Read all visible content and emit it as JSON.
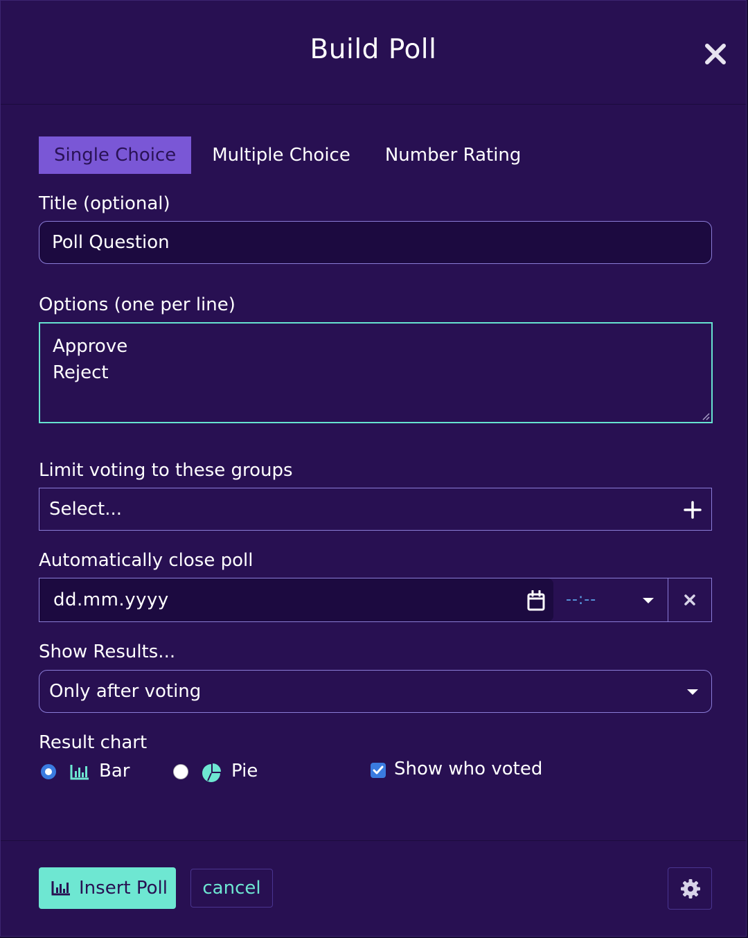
{
  "dialog": {
    "title": "Build Poll",
    "close_icon": "close-icon"
  },
  "tabs": [
    {
      "label": "Single Choice",
      "active": true
    },
    {
      "label": "Multiple Choice",
      "active": false
    },
    {
      "label": "Number Rating",
      "active": false
    }
  ],
  "form": {
    "title_label": "Title (optional)",
    "title_value": "Poll Question",
    "options_label": "Options (one per line)",
    "options": [
      "Approve",
      "Reject"
    ],
    "groups_label": "Limit voting to these groups",
    "groups_placeholder": "Select...",
    "close_label": "Automatically close poll",
    "date_placeholder": "dd.mm.yyyy",
    "time_placeholder": "--:--",
    "results_label": "Show Results...",
    "results_value": "Only after voting",
    "chart_label": "Result chart",
    "chart_options": [
      {
        "label": "Bar",
        "icon": "bar-chart-icon",
        "selected": true
      },
      {
        "label": "Pie",
        "icon": "pie-chart-icon",
        "selected": false
      }
    ],
    "show_voters_label": "Show who voted",
    "show_voters_checked": true
  },
  "footer": {
    "insert_label": "Insert Poll",
    "cancel_label": "cancel",
    "settings_icon": "gear-icon"
  },
  "colors": {
    "modal_bg": "#281052",
    "accent_teal": "#6ee7d2",
    "tab_active": "#7a57d6",
    "input_border": "#8b7dd8",
    "checkbox_blue": "#3a7be0"
  }
}
